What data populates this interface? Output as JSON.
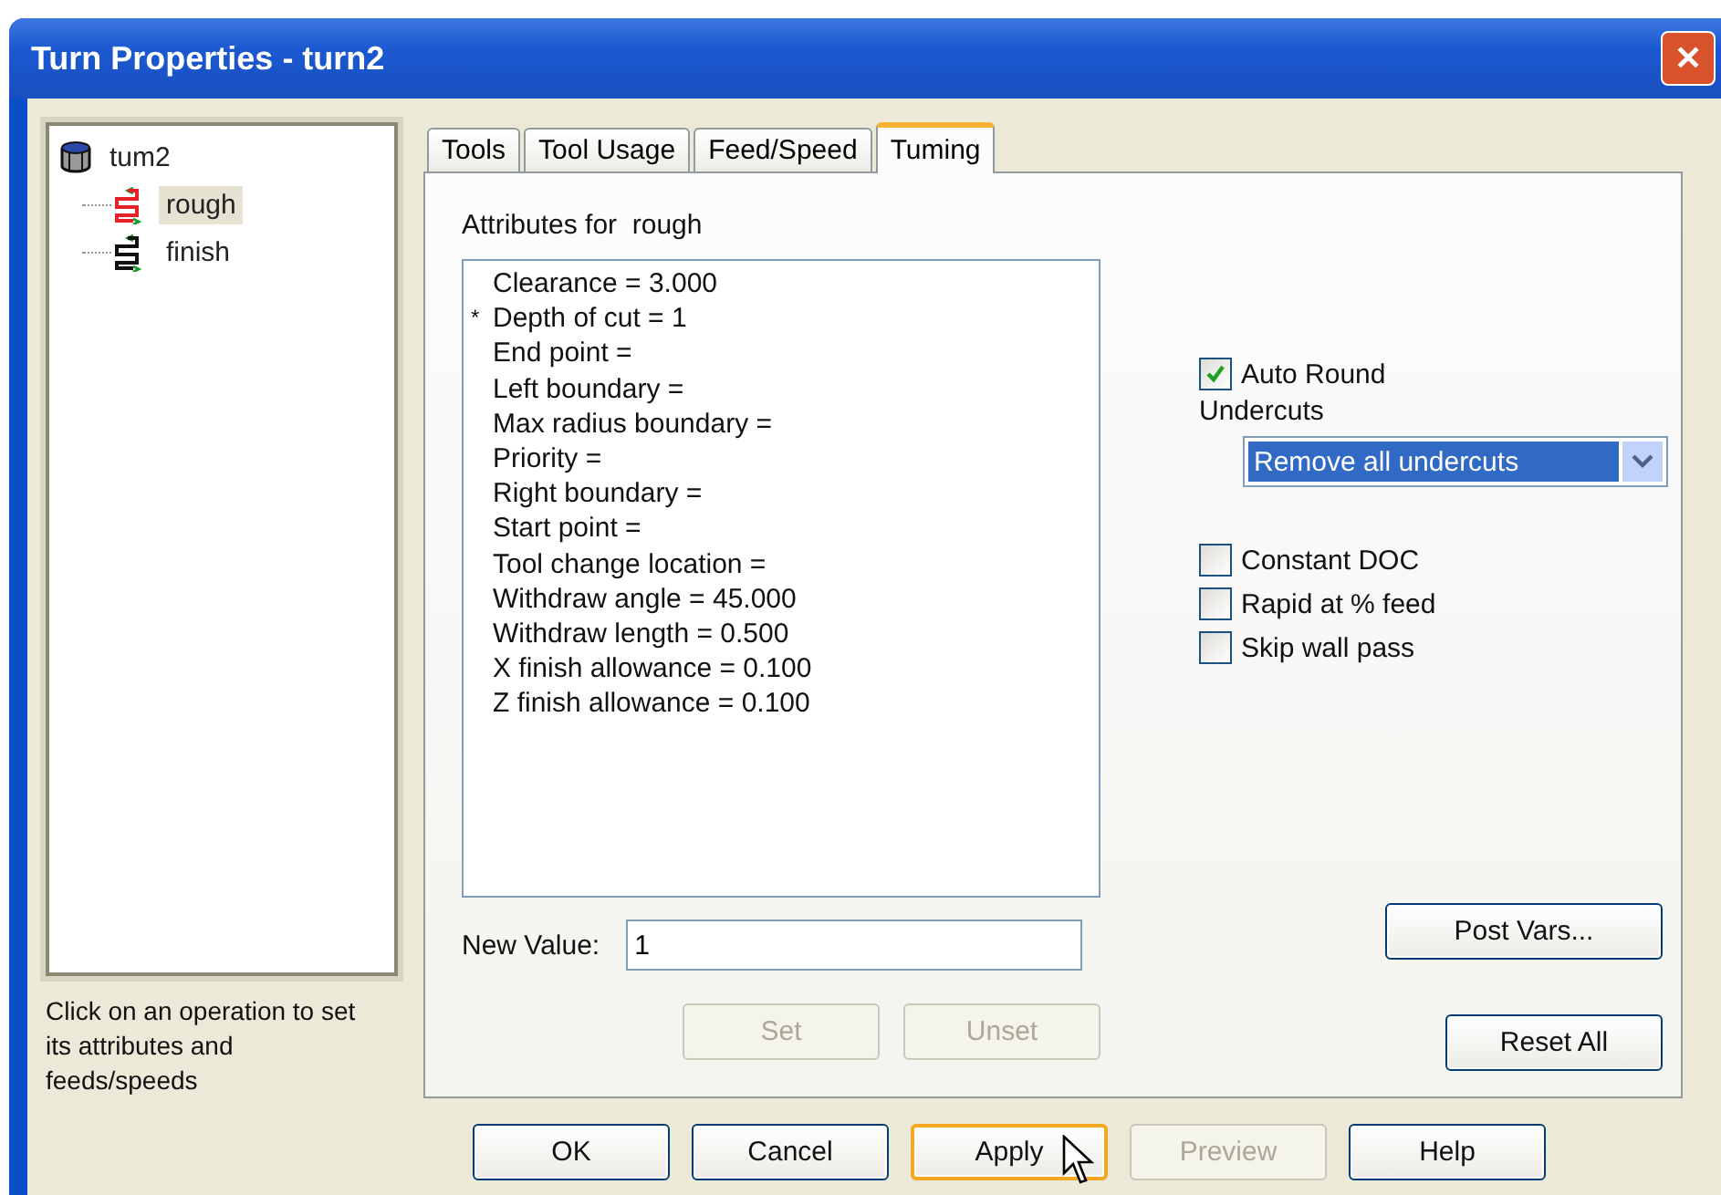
{
  "window": {
    "title": "Turn Properties - turn2",
    "close": "✕"
  },
  "tree": {
    "label": "tum2",
    "children": [
      {
        "label": "rough",
        "selected": true,
        "color": "#e8202a"
      },
      {
        "label": "finish",
        "selected": false,
        "color": "#111111"
      }
    ]
  },
  "hint": "Click on an operation to set its attributes and feeds/speeds",
  "tabs": [
    {
      "label": "Tools",
      "selected": false
    },
    {
      "label": "Tool Usage",
      "selected": false
    },
    {
      "label": "Feed/Speed",
      "selected": false
    },
    {
      "label": "Tuming",
      "selected": true
    }
  ],
  "attributes_label": "Attributes for  rough",
  "attributes": [
    {
      "text": "Clearance = 3.000"
    },
    {
      "prefix": "*",
      "text": "Depth of cut = 1"
    },
    {
      "text": "End point ="
    },
    {
      "text": "Left boundary ="
    },
    {
      "text": "Max radius boundary ="
    },
    {
      "text": "Priority ="
    },
    {
      "text": "Right boundary ="
    },
    {
      "text": "Start point ="
    },
    {
      "text": "Tool change location ="
    },
    {
      "text": "Withdraw angle = 45.000"
    },
    {
      "text": "Withdraw length = 0.500"
    },
    {
      "text": "X finish allowance = 0.100"
    },
    {
      "text": "Z finish allowance = 0.100"
    }
  ],
  "new_value": {
    "label": "New Value:",
    "value": "1"
  },
  "set_buttons": [
    {
      "label": "Set",
      "disabled": true
    },
    {
      "label": "Unset",
      "disabled": true
    }
  ],
  "auto_round": {
    "label": "Auto Round",
    "checked": true
  },
  "undercuts": {
    "label": "Undercuts",
    "value": "Remove all undercuts"
  },
  "options": [
    {
      "label": "Constant DOC",
      "checked": false
    },
    {
      "label": "Rapid at % feed",
      "checked": false
    },
    {
      "label": "Skip wall pass",
      "checked": false
    }
  ],
  "post_vars": "Post Vars...",
  "reset_all": "Reset All",
  "buttons": [
    {
      "label": "OK",
      "disabled": false,
      "hovered": false
    },
    {
      "label": "Cancel",
      "disabled": false,
      "hovered": false
    },
    {
      "label": "Apply",
      "disabled": false,
      "hovered": true
    },
    {
      "label": "Preview",
      "disabled": true,
      "hovered": false
    },
    {
      "label": "Help",
      "disabled": false,
      "hovered": false
    }
  ]
}
